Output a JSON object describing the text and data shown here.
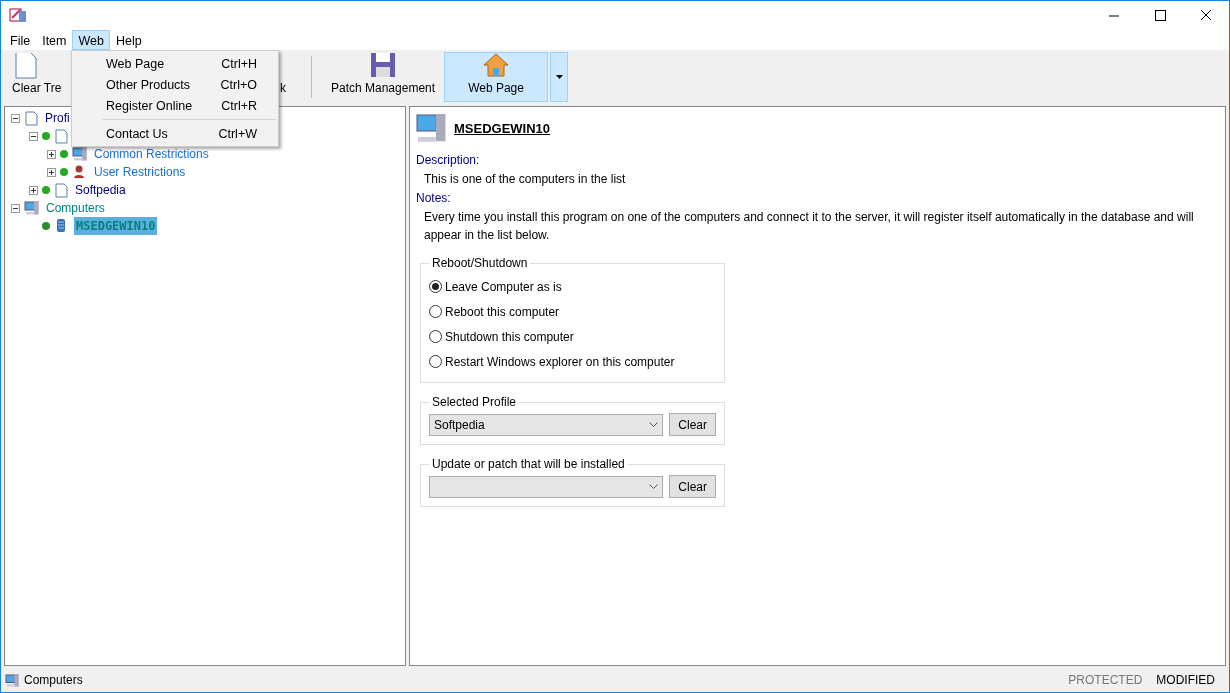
{
  "menubar": [
    {
      "label": "File",
      "open": false
    },
    {
      "label": "Item",
      "open": false
    },
    {
      "label": "Web",
      "open": true
    },
    {
      "label": "Help",
      "open": false
    }
  ],
  "open_menu": {
    "items": [
      {
        "kind": "item",
        "label": "Web Page",
        "shortcut": "Ctrl+H"
      },
      {
        "kind": "item",
        "label": "Other Products",
        "shortcut": "Ctrl+O"
      },
      {
        "kind": "item",
        "label": "Register Online",
        "shortcut": "Ctrl+R"
      },
      {
        "kind": "separator"
      },
      {
        "kind": "item",
        "label": "Contact Us",
        "shortcut": "Ctrl+W"
      }
    ]
  },
  "toolbar": [
    {
      "kind": "page",
      "label": "Clear Tre"
    },
    {
      "kind": "partial",
      "label": "k"
    },
    {
      "kind": "disk",
      "label": "Patch Management",
      "hot": false
    },
    {
      "kind": "home",
      "label": "Web Page",
      "hot": true,
      "dropdown": true
    }
  ],
  "tree": [
    {
      "label": "Profi",
      "kind": "page",
      "expanded": true,
      "children": [
        {
          "kind": "page",
          "expanded": true,
          "color": "#22aa22",
          "children": [
            {
              "label": "Common Restrictions",
              "kind": "computer",
              "expanded": false,
              "color": "#22aa22"
            },
            {
              "label": "User Restrictions",
              "kind": "user",
              "expanded": false,
              "color": "#22aa22"
            }
          ]
        },
        {
          "label": "Softpedia",
          "kind": "page",
          "expanded": false,
          "color": "#22aa22"
        }
      ]
    },
    {
      "label": "Computers",
      "kind": "computer",
      "expanded": true,
      "children": [
        {
          "label": "MSEDGEWIN10",
          "kind": "server",
          "selected": true,
          "color": "#2e8b2e"
        }
      ]
    }
  ],
  "detail": {
    "name": "MSEDGEWIN10",
    "description_label": "Description:",
    "description": "This is one of the computers in the list",
    "notes_label": "Notes:",
    "notes": "Every time you install this program on one of the computers and connect it to the server, it will register itself automatically in the database and will appear in the list below.",
    "reboot": {
      "legend": "Reboot/Shutdown",
      "options": [
        {
          "label": "Leave Computer as is",
          "selected": true
        },
        {
          "label": "Reboot this computer",
          "selected": false
        },
        {
          "label": "Shutdown this computer",
          "selected": false
        },
        {
          "label": "Restart Windows explorer on this computer",
          "selected": false
        }
      ]
    },
    "selected_profile": {
      "legend": "Selected Profile",
      "value": "Softpedia",
      "button": "Clear"
    },
    "update": {
      "legend": "Update or patch that will be installed",
      "button": "Clear"
    }
  },
  "status_bar": {
    "text": "Computers",
    "flags": [
      {
        "label": "PROTECTED",
        "on": false
      },
      {
        "label": "MODIFIED",
        "on": true
      }
    ]
  }
}
